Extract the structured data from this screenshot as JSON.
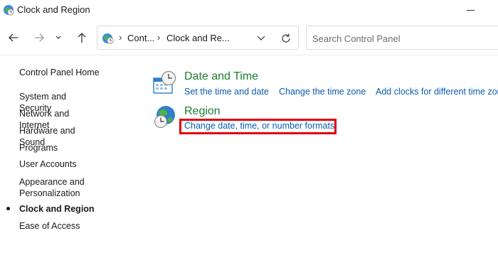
{
  "window": {
    "title": "Clock and Region",
    "icon": "clock-globe-icon"
  },
  "navigation": {
    "back_icon": "arrow-left-icon",
    "forward_icon": "arrow-right-icon",
    "recent_icon": "chevron-down-icon",
    "up_icon": "arrow-up-icon",
    "breadcrumb": [
      "Cont...",
      "Clock and Re..."
    ],
    "refresh_icon": "refresh-icon",
    "search_placeholder": "Search Control Panel"
  },
  "sidebar": {
    "home": "Control Panel Home",
    "items": [
      {
        "label": "System and Security",
        "active": false
      },
      {
        "label": "Network and Internet",
        "active": false
      },
      {
        "label": "Hardware and Sound",
        "active": false
      },
      {
        "label": "Programs",
        "active": false
      },
      {
        "label": "User Accounts",
        "active": false
      },
      {
        "label": "Appearance and Personalization",
        "active": false
      },
      {
        "label": "Clock and Region",
        "active": true
      },
      {
        "label": "Ease of Access",
        "active": false
      }
    ]
  },
  "categories": [
    {
      "title": "Date and Time",
      "icon": "calendar-clock-icon",
      "links": [
        "Set the time and date",
        "Change the time zone",
        "Add clocks for different time zones"
      ]
    },
    {
      "title": "Region",
      "icon": "globe-clock-icon",
      "links": [
        "Change date, time, or number formats"
      ]
    }
  ],
  "colors": {
    "category_title": "#1e7b2f",
    "link": "#0b5cad",
    "highlight_border": "#e0000f"
  }
}
